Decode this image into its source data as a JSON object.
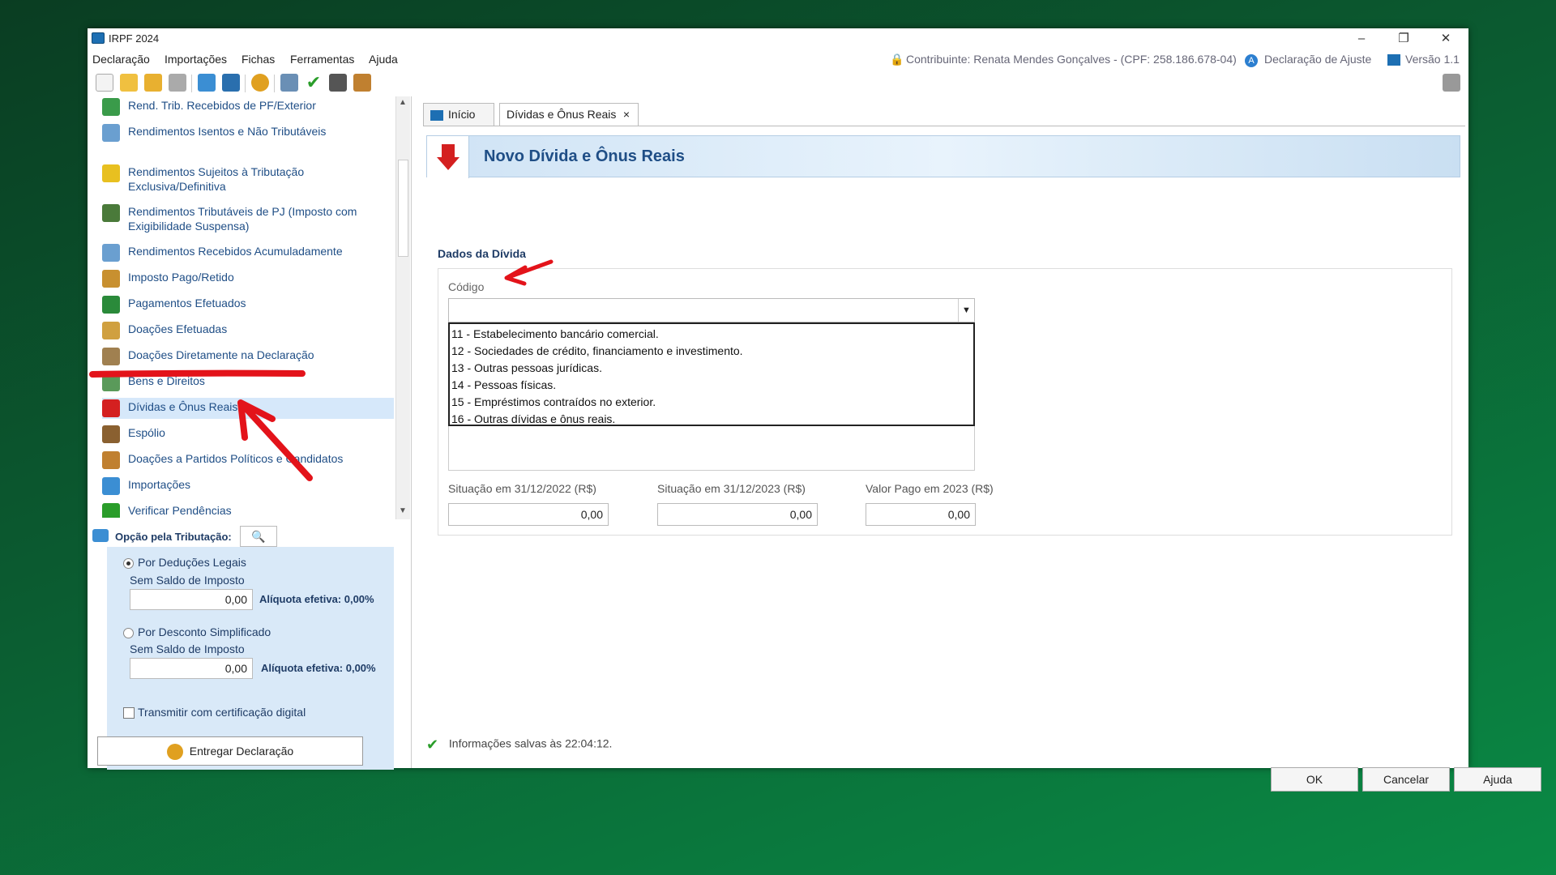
{
  "window": {
    "title": "IRPF 2024"
  },
  "menu": [
    "Declaração",
    "Importações",
    "Fichas",
    "Ferramentas",
    "Ajuda"
  ],
  "header": {
    "contribuinte": "Contribuinte: Renata Mendes Gonçalves - (CPF: 258.186.678-04)",
    "declaracao": "Declaração de Ajuste",
    "versao": "Versão 1.1"
  },
  "toolbar_icons": [
    "new-icon",
    "open-icon",
    "folder-icon",
    "trash-icon",
    "import-icon",
    "export-icon",
    "globe-icon",
    "print-icon",
    "check-icon",
    "calculator-icon",
    "help-icon"
  ],
  "nav": [
    {
      "label": "Rend. Trib. Recebidos de PF/Exterior",
      "icon": "exterior-icon"
    },
    {
      "label": "Rendimentos Isentos e Não Tributáveis",
      "icon": "isentos-icon"
    },
    {
      "label": "Rendimentos Sujeitos à Tributação Exclusiva/Definitiva",
      "icon": "warning-icon"
    },
    {
      "label": "Rendimentos Tributáveis de PJ (Imposto com Exigibilidade Suspensa)",
      "icon": "suspensa-icon"
    },
    {
      "label": "Rendimentos Recebidos Acumuladamente",
      "icon": "acumulado-icon"
    },
    {
      "label": "Imposto Pago/Retido",
      "icon": "imposto-icon"
    },
    {
      "label": "Pagamentos Efetuados",
      "icon": "card-icon"
    },
    {
      "label": "Doações Efetuadas",
      "icon": "doacao-icon"
    },
    {
      "label": "Doações Diretamente na Declaração",
      "icon": "doacao-direta-icon"
    },
    {
      "label": "Bens e Direitos",
      "icon": "bens-icon"
    },
    {
      "label": "Dívidas e Ônus Reais",
      "icon": "divida-icon"
    },
    {
      "label": "Espólio",
      "icon": "espolio-icon"
    },
    {
      "label": "Doações a Partidos Políticos e Candidatos",
      "icon": "partidos-icon"
    },
    {
      "label": "Importações",
      "icon": "importacoes-icon"
    },
    {
      "label": "Verificar Pendências",
      "icon": "check-icon"
    }
  ],
  "opcao": {
    "title": "Opção pela Tributação:",
    "legais": "Por Deduções Legais",
    "legais_saldo": "Sem Saldo de Imposto",
    "legais_valor": "0,00",
    "legais_aliquota": "Alíquota efetiva: 0,00%",
    "simplificado": "Por Desconto Simplificado",
    "simpl_saldo": "Sem Saldo de Imposto",
    "simpl_valor": "0,00",
    "simpl_aliquota": "Alíquota efetiva: 0,00%",
    "certificacao": "Transmitir com certificação digital",
    "entregar": "Entregar Declaração"
  },
  "tabs": {
    "inicio": "Início",
    "dividas": "Dívidas e Ônus Reais",
    "close": "×"
  },
  "banner_title": "Novo Dívida e Ônus Reais",
  "form": {
    "section": "Dados da Dívida",
    "codigo_label": "Código",
    "options": [
      "11 - Estabelecimento bancário comercial.",
      "12 - Sociedades de crédito, financiamento e investimento.",
      "13 - Outras pessoas jurídicas.",
      "14 - Pessoas físicas.",
      "15 - Empréstimos contraídos no exterior.",
      "16 - Outras dívidas e ônus reais."
    ],
    "sit2022_label": "Situação em 31/12/2022 (R$)",
    "sit2022_value": "0,00",
    "sit2023_label": "Situação em 31/12/2023 (R$)",
    "sit2023_value": "0,00",
    "pago_label": "Valor Pago em 2023 (R$)",
    "pago_value": "0,00"
  },
  "status": "Informações salvas às 22:04:12.",
  "buttons": {
    "ok": "OK",
    "cancelar": "Cancelar",
    "ajuda": "Ajuda"
  },
  "colors": {
    "link": "#1f4e86",
    "selected": "#d6e8fa",
    "annotation": "#e3131a"
  }
}
